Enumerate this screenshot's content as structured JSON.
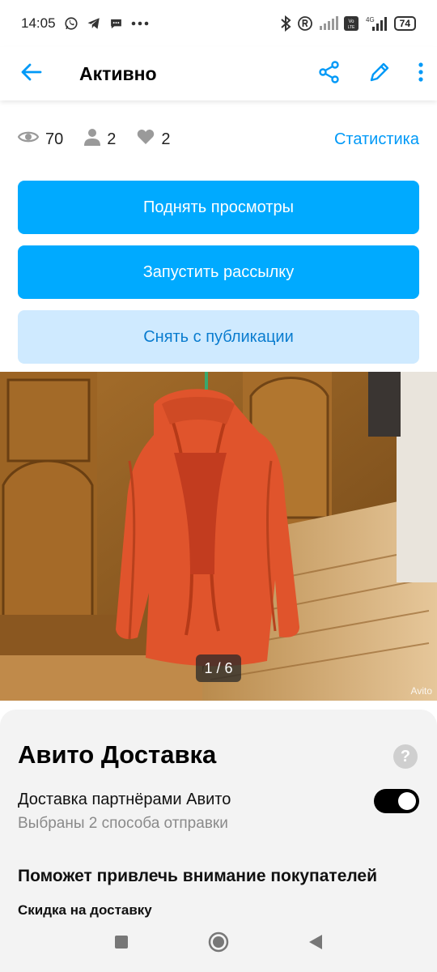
{
  "status_bar": {
    "time": "14:05",
    "battery": "74",
    "network": "4G"
  },
  "app_bar": {
    "title": "Активно"
  },
  "stats": {
    "views": "70",
    "contacts": "2",
    "favorites": "2",
    "link_label": "Статистика"
  },
  "actions": {
    "boost_label": "Поднять просмотры",
    "mailing_label": "Запустить рассылку",
    "unpublish_label": "Снять с публикации"
  },
  "photo": {
    "counter": "1 / 6",
    "watermark": "Avito"
  },
  "delivery": {
    "title": "Авито Доставка",
    "help_glyph": "?",
    "option_title": "Доставка партнёрами Авито",
    "option_subtitle": "Выбраны 2 способа отправки",
    "toggle_on": true,
    "promo_title": "Поможет привлечь внимание покупателей",
    "promo_item": "Скидка на доставку"
  },
  "colors": {
    "accent": "#00aaff",
    "secondary_button_bg": "#cfeaff",
    "secondary_button_text": "#0a7ccf",
    "link": "#0099f7",
    "panel_bg": "#f3f3f3"
  }
}
